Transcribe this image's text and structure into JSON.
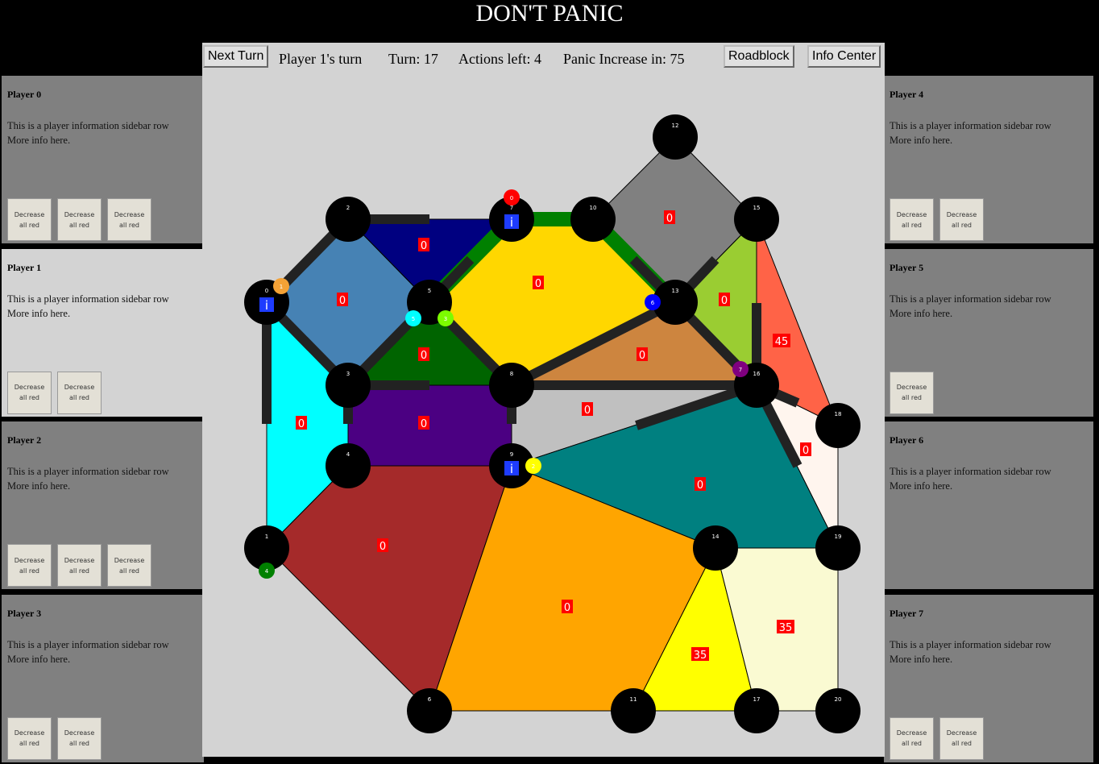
{
  "title": "DON'T PANIC",
  "top_bar": {
    "next_turn": "Next Turn",
    "player_turn": "Player 1's turn",
    "turn": "Turn: 17",
    "actions": "Actions left: 4",
    "panic": "Panic Increase in: 75",
    "roadblock": "Roadblock",
    "info_center": "Info Center"
  },
  "players_left": [
    {
      "name": "Player 0",
      "info": "This is a player information sidebar row",
      "more": "More info here.",
      "buttons": [
        "Decrease all red",
        "Decrease all red",
        "Decrease all red"
      ]
    },
    {
      "name": "Player 1",
      "info": "This is a player information sidebar row",
      "more": "More info here.",
      "buttons": [
        "Decrease all red",
        "Decrease all red"
      ],
      "active": true
    },
    {
      "name": "Player 2",
      "info": "This is a player information sidebar row",
      "more": "More info here.",
      "buttons": [
        "Decrease all red",
        "Decrease all red",
        "Decrease all red"
      ]
    },
    {
      "name": "Player 3",
      "info": "This is a player information sidebar row",
      "more": "More info here.",
      "buttons": [
        "Decrease all red",
        "Decrease all red"
      ]
    }
  ],
  "players_right": [
    {
      "name": "Player 4",
      "info": "This is a player information sidebar row",
      "more": "More info here.",
      "buttons": [
        "Decrease all red",
        "Decrease all red"
      ]
    },
    {
      "name": "Player 5",
      "info": "This is a player information sidebar row",
      "more": "More info here.",
      "buttons": [
        "Decrease all red"
      ]
    },
    {
      "name": "Player 6",
      "info": "This is a player information sidebar row",
      "more": "More info here.",
      "buttons": []
    },
    {
      "name": "Player 7",
      "info": "This is a player information sidebar row",
      "more": "More info here.",
      "buttons": [
        "Decrease all red",
        "Decrease all red"
      ]
    }
  ],
  "board": {
    "nodes": [
      {
        "id": "0",
        "info": true
      },
      {
        "id": "1"
      },
      {
        "id": "2"
      },
      {
        "id": "3"
      },
      {
        "id": "4"
      },
      {
        "id": "5"
      },
      {
        "id": "6"
      },
      {
        "id": "7",
        "info": true
      },
      {
        "id": "8"
      },
      {
        "id": "9",
        "info": true
      },
      {
        "id": "10"
      },
      {
        "id": "11"
      },
      {
        "id": "12"
      },
      {
        "id": "13"
      },
      {
        "id": "14"
      },
      {
        "id": "15"
      },
      {
        "id": "16"
      },
      {
        "id": "17"
      },
      {
        "id": "18"
      },
      {
        "id": "19"
      },
      {
        "id": "20"
      }
    ],
    "zones": [
      {
        "color": "#4682b4",
        "panic": "0"
      },
      {
        "color": "#000080",
        "panic": "0"
      },
      {
        "color": "#ffd700",
        "panic": "0"
      },
      {
        "color": "#808080",
        "panic": "0"
      },
      {
        "color": "#9acd32",
        "panic": "0"
      },
      {
        "color": "#ff6347",
        "panic": "45"
      },
      {
        "color": "#006400",
        "panic": "0"
      },
      {
        "color": "#cd853f",
        "panic": "0"
      },
      {
        "color": "#00ffff",
        "panic": "0"
      },
      {
        "color": "#4b0082",
        "panic": "0"
      },
      {
        "color": "#c0c0c0",
        "panic": "0"
      },
      {
        "color": "#fff5ee",
        "panic": "0"
      },
      {
        "color": "#a52a2a",
        "panic": "0"
      },
      {
        "color": "#ffa500",
        "panic": "0"
      },
      {
        "color": "#008080",
        "panic": "0"
      },
      {
        "color": "#ffff00",
        "panic": "35"
      },
      {
        "color": "#fafad2",
        "panic": "35"
      }
    ],
    "pawns": [
      {
        "label": "0",
        "color": "#ff0000"
      },
      {
        "label": "1",
        "color": "#f4a236"
      },
      {
        "label": "2",
        "color": "#ffff00"
      },
      {
        "label": "3",
        "color": "#7cfc00"
      },
      {
        "label": "4",
        "color": "#008000"
      },
      {
        "label": "5",
        "color": "#00ffff"
      },
      {
        "label": "6",
        "color": "#0000ff"
      },
      {
        "label": "7",
        "color": "#800080"
      }
    ]
  }
}
